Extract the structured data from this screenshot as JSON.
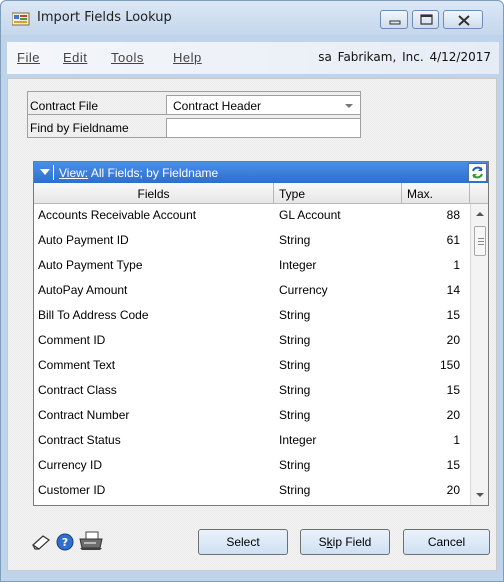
{
  "window": {
    "title": "Import Fields Lookup",
    "icon": "import-app-icon"
  },
  "menu": {
    "items": [
      "File",
      "Edit",
      "Tools",
      "Help"
    ],
    "info": "sa  Fabrikam, Inc.  4/12/2017"
  },
  "form": {
    "contract_file_label": "Contract File",
    "contract_file_value": "Contract Header",
    "find_label": "Find by Fieldname",
    "find_value": ""
  },
  "view": {
    "label_prefix": "View:",
    "label_text": " All Fields; by Fieldname"
  },
  "table": {
    "headers": [
      "Fields",
      "Type",
      "Max."
    ],
    "rows": [
      {
        "field": "Accounts Receivable Account",
        "type": "GL Account",
        "max": "88"
      },
      {
        "field": "Auto Payment ID",
        "type": "String",
        "max": "61"
      },
      {
        "field": "Auto Payment Type",
        "type": "Integer",
        "max": "1"
      },
      {
        "field": "AutoPay Amount",
        "type": "Currency",
        "max": "14"
      },
      {
        "field": "Bill To Address Code",
        "type": "String",
        "max": "15"
      },
      {
        "field": "Comment ID",
        "type": "String",
        "max": "20"
      },
      {
        "field": "Comment Text",
        "type": "String",
        "max": "150"
      },
      {
        "field": "Contract Class",
        "type": "String",
        "max": "15"
      },
      {
        "field": "Contract Number",
        "type": "String",
        "max": "20"
      },
      {
        "field": "Contract Status",
        "type": "Integer",
        "max": "1"
      },
      {
        "field": "Currency ID",
        "type": "String",
        "max": "15"
      },
      {
        "field": "Customer ID",
        "type": "String",
        "max": "20"
      }
    ]
  },
  "buttons": {
    "select": "Select",
    "skip_prefix": "S",
    "skip_underlined": "k",
    "skip_rest": "ip Field",
    "cancel": "Cancel"
  },
  "icons": {
    "note": "note-icon",
    "help": "help-icon",
    "printer": "printer-icon",
    "refresh": "refresh-icon"
  },
  "colors": {
    "view_bar": "#2c6fcf",
    "window_frame": "#bfd3ea"
  }
}
